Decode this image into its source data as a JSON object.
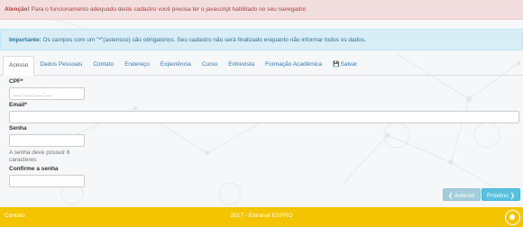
{
  "alerts": {
    "danger_strong": "Atenção!",
    "danger_text": " Para o funcionamento adequado deste cadastro você precisa ter o javascript habilitado no seu navegador.",
    "info_strong": "Importante:",
    "info_text": " Os campos com um \"*\"(asterisco) são obrigatórios. Seu cadastro não será finalizado enquanto não informar todos os dados."
  },
  "tabs": [
    {
      "label": "Acesso",
      "active": true
    },
    {
      "label": "Dados Pessoais"
    },
    {
      "label": "Contato"
    },
    {
      "label": "Endereço"
    },
    {
      "label": "Experiência"
    },
    {
      "label": "Curso"
    },
    {
      "label": "Entrevista"
    },
    {
      "label": "Formação Acadêmica"
    },
    {
      "label": "Salvar",
      "icon": "save-icon"
    }
  ],
  "form": {
    "cpf_label": "CPF*",
    "cpf_placeholder": "___.___.___-__",
    "email_label": "Email*",
    "senha_label": "Senha",
    "senha_help": "A senha deve possuir 6 caracteres",
    "confirme_label": "Confirme a senha"
  },
  "buttons": {
    "prev_label": "Anterior",
    "next_label": "Próximo"
  },
  "footer": {
    "left": "Contato",
    "center": "2017 - Extranet ESPRO"
  }
}
